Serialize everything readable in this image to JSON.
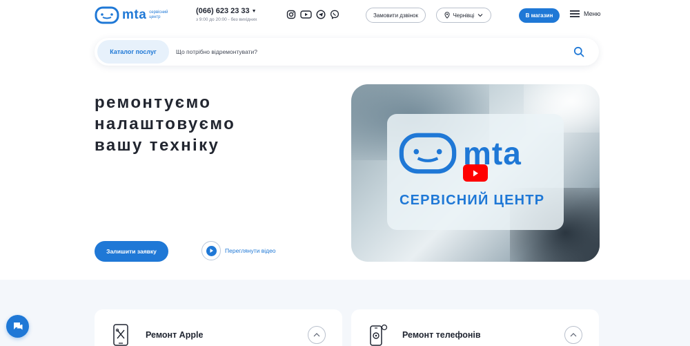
{
  "header": {
    "logo_text": "mta",
    "logo_subtitle": "сервісний центр",
    "phone": "(066) 623 23 33",
    "hours": "з 9:00 до 20:00 - без вихідних",
    "socials": [
      "instagram-icon",
      "youtube-icon",
      "telegram-icon",
      "viber-icon"
    ],
    "callback_label": "Замовити дзвінок",
    "city_label": "Чернівці",
    "shop_label": "В магазин",
    "menu_label": "Меню"
  },
  "search": {
    "catalog_label": "Каталог послуг",
    "placeholder": "Що потрібно відремонтувати?"
  },
  "hero": {
    "lines": [
      "ремонтуємо",
      "налаштовуємо",
      "вашу техніку"
    ],
    "request_label": "Залишити заявку",
    "watch_label": "Переглянути відео"
  },
  "video": {
    "logo_text": "mta",
    "subtitle": "СЕРВІСНИЙ ЦЕНТР"
  },
  "services": [
    {
      "title": "Ремонт Apple",
      "icon": "tablet-repair-icon"
    },
    {
      "title": "Ремонт телефонів",
      "icon": "phone-repair-icon"
    }
  ],
  "colors": {
    "accent": "#1f78d6",
    "youtube": "#ff0000",
    "section_bg": "#f4f7fb"
  }
}
